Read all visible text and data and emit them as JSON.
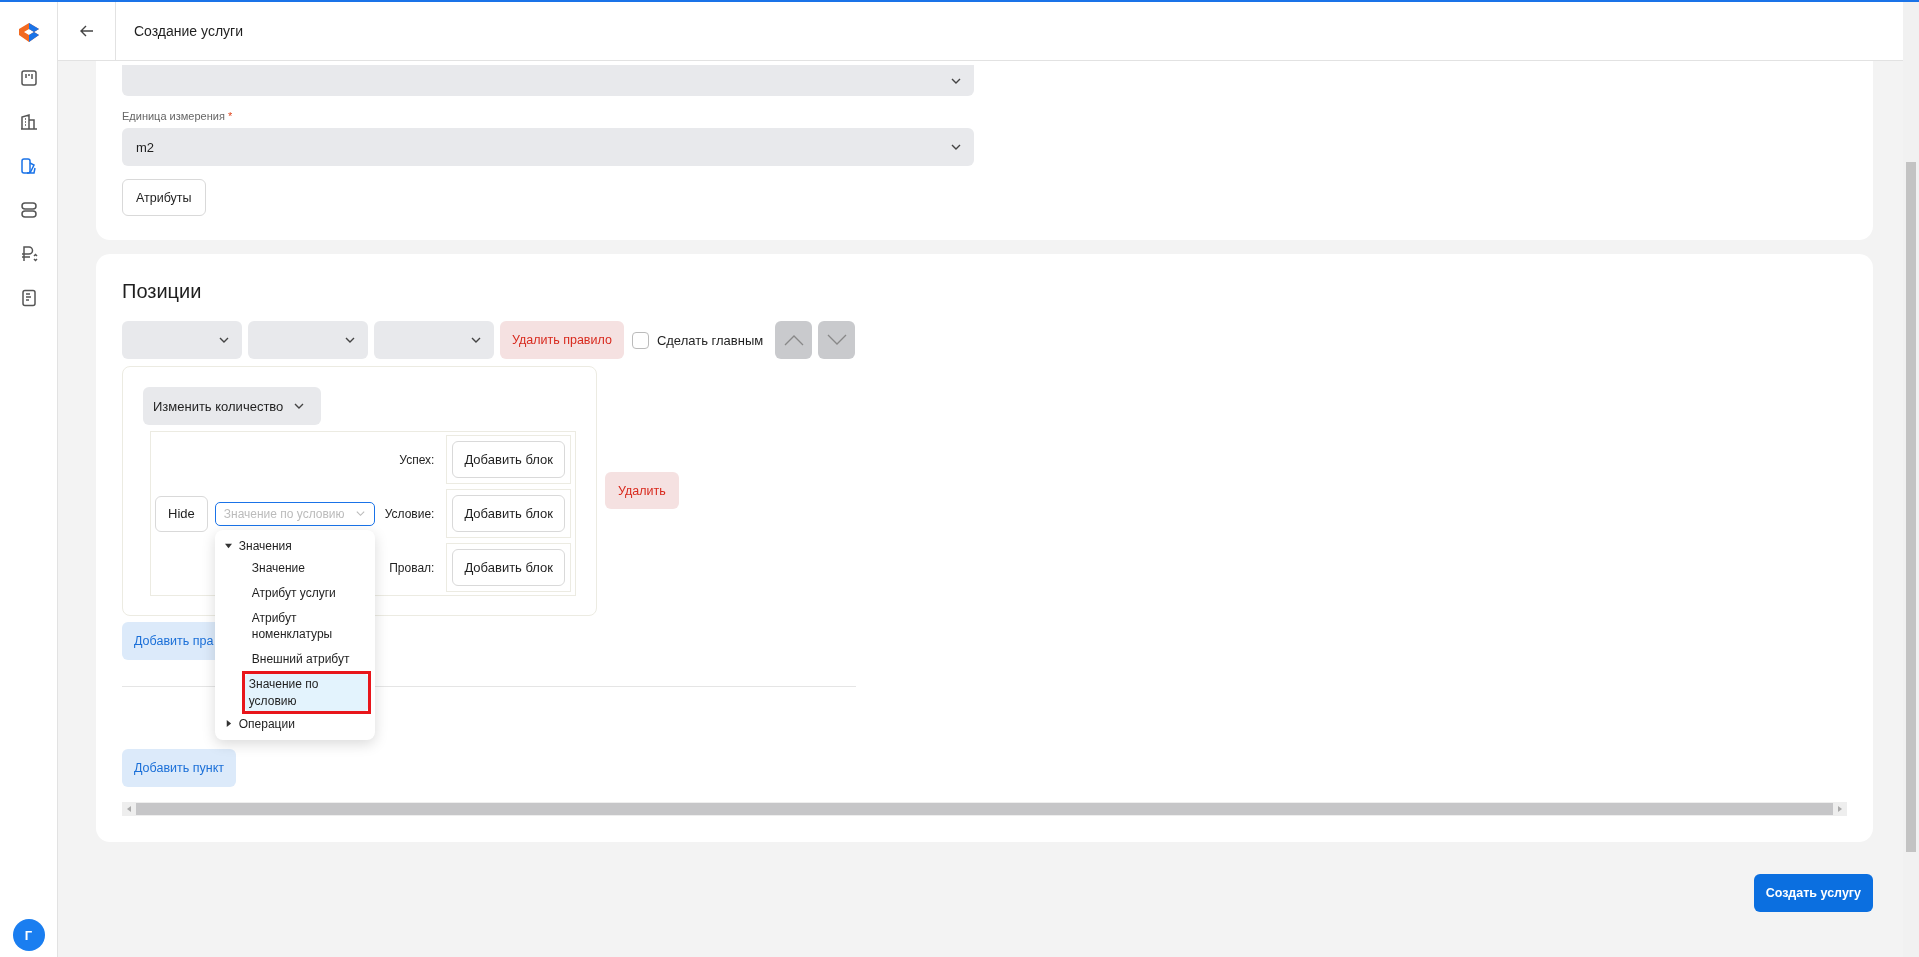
{
  "sidebar": {
    "items": [
      {
        "kind": "board",
        "selected": false
      },
      {
        "kind": "building",
        "selected": false
      },
      {
        "kind": "catalog",
        "selected": true
      },
      {
        "kind": "servers",
        "selected": false
      },
      {
        "kind": "ruble",
        "selected": false
      },
      {
        "kind": "document",
        "selected": false
      }
    ],
    "avatar": "Г"
  },
  "header": {
    "title": "Создание услуги"
  },
  "service": {
    "unit_field": {
      "label": "Единица измерения",
      "required_mark": "*",
      "value": "m2"
    },
    "attributes_button": "Атрибуты"
  },
  "positions": {
    "title": "Позиции",
    "delete_rule_button": "Удалить правило",
    "make_main": {
      "label": "Сделать главным",
      "checked": false
    },
    "action_select": {
      "value": "Изменить количество"
    },
    "condition": {
      "hide_button": "Hide",
      "value_select": {
        "placeholder": "Значение по условию",
        "focused": true
      },
      "branches": [
        {
          "label": "Успех:",
          "button": "Добавить блок"
        },
        {
          "label": "Условие:",
          "button": "Добавить блок"
        },
        {
          "label": "Провал:",
          "button": "Добавить блок"
        }
      ]
    },
    "delete_button": "Удалить",
    "dropdown": {
      "groups": [
        {
          "label": "Значения",
          "expanded": true,
          "children": [
            {
              "label": "Значение",
              "selected": false,
              "highlighted": false
            },
            {
              "label": "Атрибут услуги",
              "selected": false,
              "highlighted": false
            },
            {
              "label": "Атрибут номенклатуры",
              "selected": false,
              "highlighted": false
            },
            {
              "label": "Внешний атрибут",
              "selected": false,
              "highlighted": false
            },
            {
              "label": "Значение по условию",
              "selected": true,
              "highlighted": true
            }
          ]
        },
        {
          "label": "Операции",
          "expanded": false
        }
      ]
    },
    "add_rule_button": "Добавить пра",
    "add_item_button": "Добавить пункт"
  },
  "submit_button": "Создать услугу"
}
